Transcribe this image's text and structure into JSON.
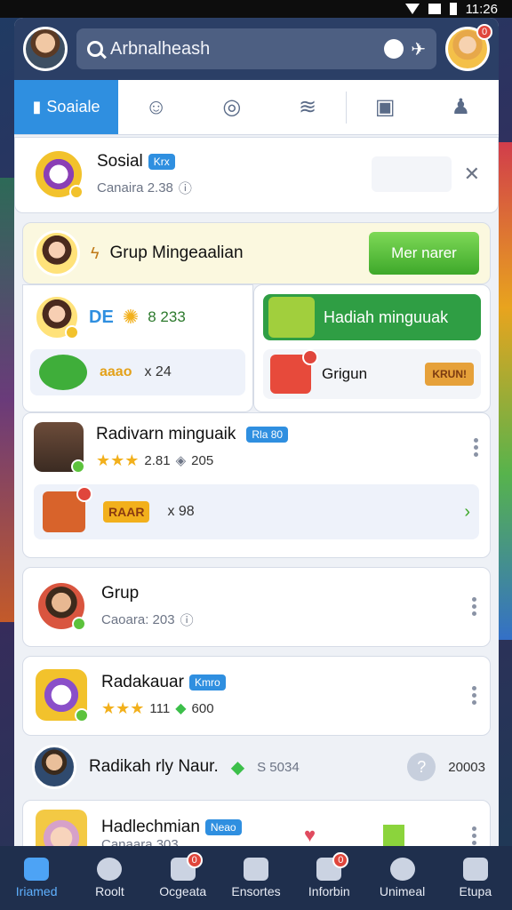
{
  "status": {
    "time": "11:26"
  },
  "search": {
    "value": "Arbnalheash"
  },
  "profile": {
    "badge": "0"
  },
  "tabs": [
    {
      "label": "Soaiale"
    }
  ],
  "social_card": {
    "title": "Sosial",
    "tag": "Krx",
    "subtitle": "Canaira 2.38"
  },
  "group_banner": {
    "title": "Grup Mingeaalian",
    "button": "Mer narer"
  },
  "left_panel": {
    "pill": "DE",
    "value1": "8 233",
    "coin_label": "aaao",
    "value2": "x 24"
  },
  "right_panel": {
    "button": "Hadiah minguuak",
    "gift_label": "Grigun",
    "sign": "KRUN!"
  },
  "reward_card": {
    "title": "Radivarn minguaik",
    "tag": "Rla 80",
    "rating": "2.81",
    "count": "205",
    "coin_label": "RAAR",
    "amount": "x 98"
  },
  "grup_card": {
    "title": "Grup",
    "subtitle": "Caoara: 203"
  },
  "radakauar_card": {
    "title": "Radakauar",
    "tag": "Kmro",
    "rating": "111",
    "gems": "600"
  },
  "radikah_row": {
    "title": "Radikah rly Naur.",
    "amount": "S 5034",
    "count": "20003"
  },
  "hadlechmian_card": {
    "title": "Hadlechmian",
    "tag": "Neao",
    "subtitle": "Canaara 303"
  },
  "nav": [
    {
      "label": "Iriamed",
      "badge": ""
    },
    {
      "label": "Roolt",
      "badge": ""
    },
    {
      "label": "Ocgeata",
      "badge": "0"
    },
    {
      "label": "Ensortes",
      "badge": ""
    },
    {
      "label": "Inforbin",
      "badge": "0"
    },
    {
      "label": "Unimeal",
      "badge": ""
    },
    {
      "label": "Etupa",
      "badge": ""
    }
  ],
  "colors": {
    "accent": "#2f8fe0",
    "topbar": "#2b3f66",
    "green": "#3ea82a",
    "nav": "#1f2f4d"
  }
}
